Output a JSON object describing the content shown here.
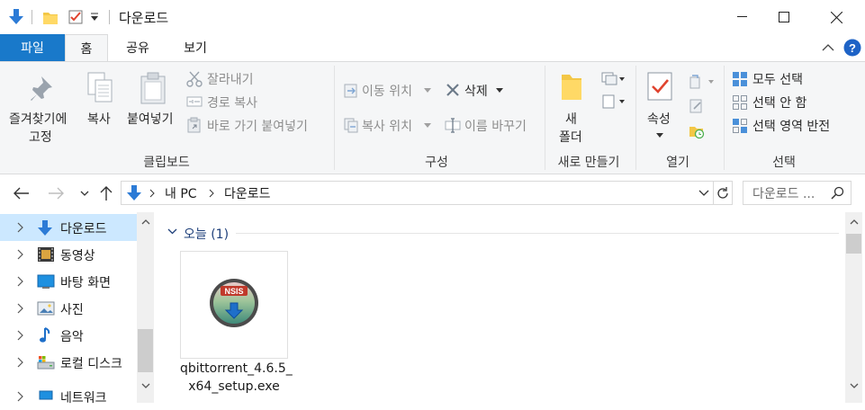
{
  "window": {
    "title": "다운로드"
  },
  "tabs": {
    "file": "파일",
    "home": "홈",
    "share": "공유",
    "view": "보기"
  },
  "ribbon": {
    "clipboard": {
      "pin": "즐겨찾기에",
      "pin2": "고정",
      "copy": "복사",
      "paste": "붙여넣기",
      "cut": "잘라내기",
      "copy_path": "경로 복사",
      "paste_shortcut": "바로 가기 붙여넣기",
      "label": "클립보드"
    },
    "organize": {
      "move_to": "이동 위치",
      "delete": "삭제",
      "copy_to": "복사 위치",
      "rename": "이름 바꾸기",
      "label": "구성"
    },
    "new": {
      "new_folder": "새",
      "new_folder2": "폴더",
      "label": "새로 만들기"
    },
    "open": {
      "properties": "속성",
      "label": "열기"
    },
    "select": {
      "select_all": "모두 선택",
      "select_none": "선택 안 함",
      "invert": "선택 영역 반전",
      "label": "선택"
    }
  },
  "address": {
    "crumbs": [
      "내 PC",
      "다운로드"
    ],
    "search_placeholder": "다운로드 ..."
  },
  "nav": {
    "items": [
      {
        "label": "다운로드"
      },
      {
        "label": "동영상"
      },
      {
        "label": "바탕 화면"
      },
      {
        "label": "사진"
      },
      {
        "label": "음악"
      },
      {
        "label": "로컬 디스크"
      },
      {
        "label": "네트워크"
      }
    ]
  },
  "content": {
    "group_header": "오늘 (1)",
    "file": {
      "name_line1": "qbittorrent_4.6.5_",
      "name_line2": "x64_setup.exe",
      "icon_text": "NSIS"
    }
  },
  "colors": {
    "accent": "#1979ca",
    "selection": "#cce8ff",
    "help": "#1e63c6"
  }
}
